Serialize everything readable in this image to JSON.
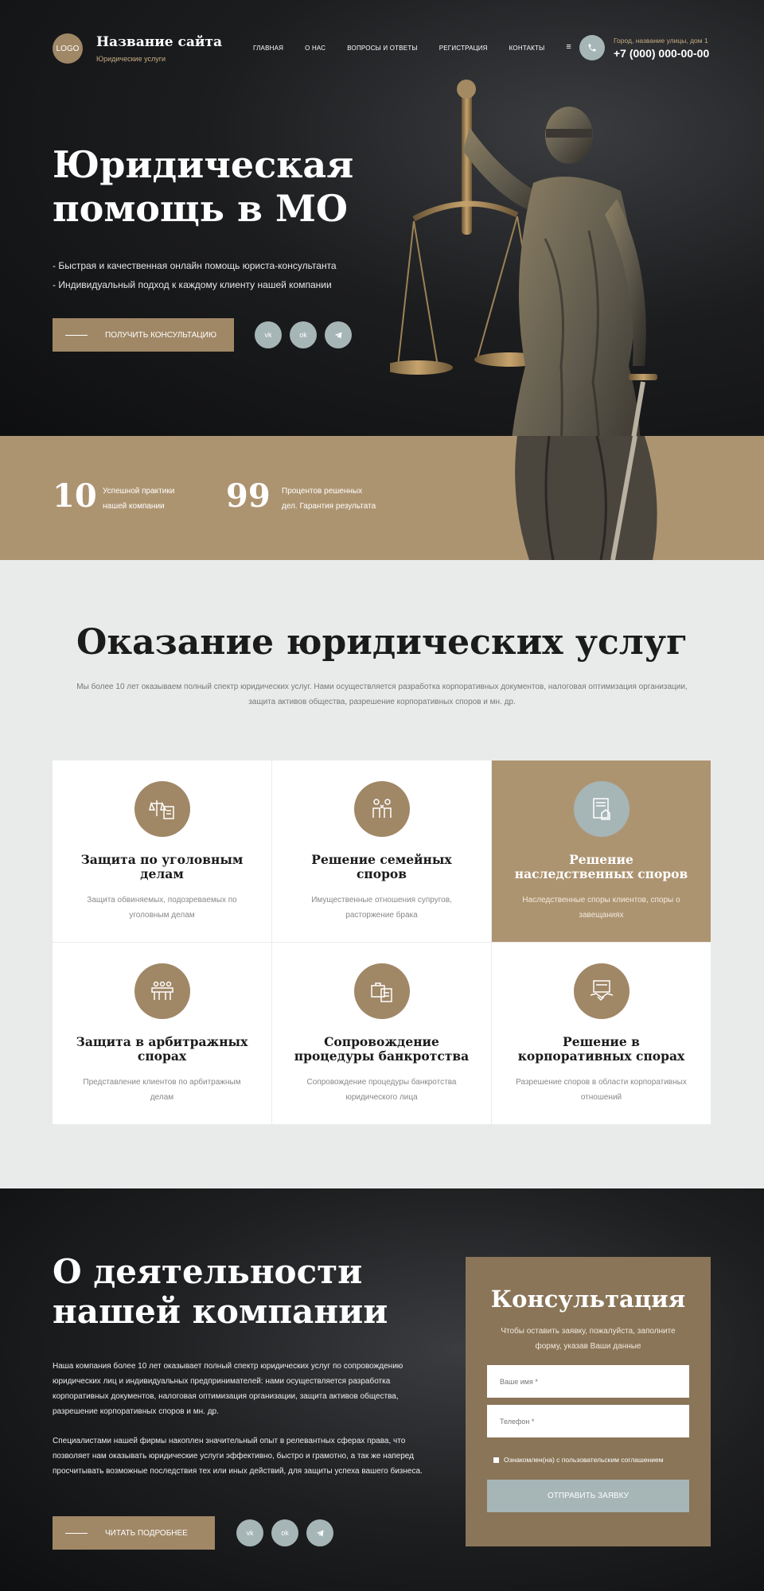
{
  "header": {
    "logo": "LOGO",
    "site_title": "Название сайта",
    "site_subtitle": "Юридические услуги",
    "nav": [
      "Главная",
      "О нас",
      "Вопросы и ответы",
      "Регистрация",
      "Контакты"
    ],
    "menu_icon": "≡",
    "address": "Город, название улицы, дом 1",
    "phone": "+7 (000) 000-00-00"
  },
  "hero": {
    "title": "Юридическая помощь в МО",
    "bullets": [
      "- Быстрая и качественная онлайн помощь юриста-консультанта",
      "- Индивидуальный подход к каждому клиенту нашей компании"
    ],
    "cta": "Получить консультацию",
    "social": [
      "vk",
      "ok",
      "tg"
    ]
  },
  "stats": [
    {
      "number": "10",
      "line1": "Успешной практики",
      "line2": "нашей компании"
    },
    {
      "number": "99",
      "line1": "Процентов решенных",
      "line2": "дел. Гарантия результата"
    }
  ],
  "services": {
    "title": "Оказание юридических услуг",
    "description": "Мы более 10 лет оказываем полный спектр юридических услуг. Нами осуществляется разработка корпоративных документов, налоговая оптимизация организации, защита активов общества, разрешение корпоративных споров и мн. др.",
    "items": [
      {
        "title": "Защита по уголовным делам",
        "text": "Защита обвиняемых, подозреваемых по уголовным делам",
        "icon": "scales-document-icon"
      },
      {
        "title": "Решение семейных споров",
        "text": "Имущественные отношения супругов, расторжение брака",
        "icon": "family-dispute-icon"
      },
      {
        "title": "Решение наследственных споров",
        "text": "Наследственные споры клиентов, споры о завещаниях",
        "icon": "inheritance-document-icon"
      },
      {
        "title": "Защита в арбитражных спорах",
        "text": "Представление клиентов по арбитражным делам",
        "icon": "arbitration-court-icon"
      },
      {
        "title": "Сопровождение процедуры банкротства",
        "text": "Сопровождение процедуры банкротства юридического лица",
        "icon": "briefcase-document-icon"
      },
      {
        "title": "Решение в корпоративных спорах",
        "text": "Разрешение споров в области корпоративных отношений",
        "icon": "handshake-icon"
      }
    ]
  },
  "about": {
    "title": "О деятельности нашей компании",
    "p1": "Наша компания более 10 лет оказывает полный спектр юридических услуг по сопровождению юридических лиц и индивидуальных предпринимателей: нами осуществляется разработка корпоративных документов, налоговая оптимизация организации, защита активов общества, разрешение корпоративных споров и мн. др.",
    "p2": "Специалистами нашей фирмы накоплен значительный опыт в релевантных сферах права, что позволяет нам оказывать юридические услуги эффективно, быстро и грамотно, а так же наперед просчитывать возможные последствия тех или иных действий, для защиты успеха вашего бизнеса.",
    "cta": "Читать подробнее"
  },
  "form": {
    "title": "Консультация",
    "subtitle": "Чтобы оставить заявку, пожалуйста, заполните форму, указав Ваши данные",
    "name_placeholder": "Ваше имя *",
    "phone_placeholder": "Телефон *",
    "agree": "Ознакомлен(на) с пользовательским соглашением",
    "submit": "Отправить заявку"
  },
  "colors": {
    "accent": "#ad9471",
    "accent_dark": "#8a7558",
    "muted_blue": "#a6b5b6",
    "dark": "#1c1d1f"
  }
}
